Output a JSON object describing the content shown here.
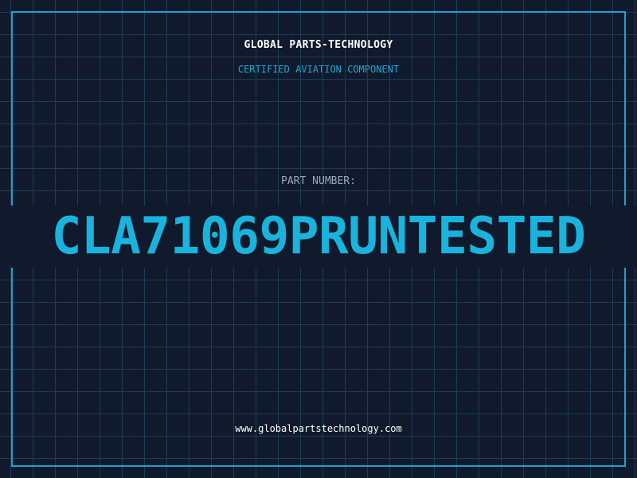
{
  "header": {
    "company": "GLOBAL PARTS-TECHNOLOGY",
    "tagline": "CERTIFIED AVIATION COMPONENT"
  },
  "part": {
    "label": "PART NUMBER:",
    "number": "CLA71069PRUNTESTED"
  },
  "footer": {
    "website": "www.globalpartstechnology.com"
  },
  "colors": {
    "background": "#101a2c",
    "grid": "#1b3d55",
    "accent": "#19b3dd",
    "frame": "#1aa3cf",
    "label": "#9aa8b8",
    "text": "#ffffff"
  }
}
